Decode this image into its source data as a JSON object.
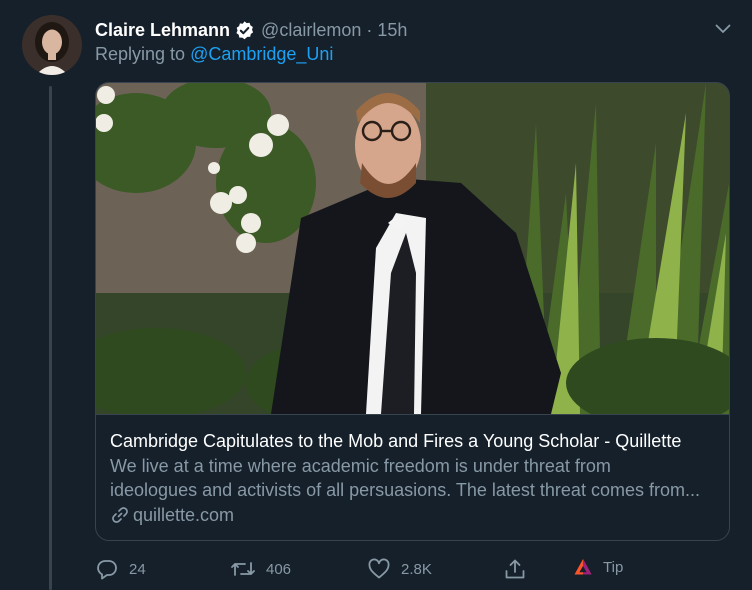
{
  "tweet": {
    "display_name": "Claire Lehmann",
    "handle": "@clairlemon",
    "separator": "·",
    "time": "15h",
    "replying_prefix": "Replying to",
    "replying_to": "@Cambridge_Uni"
  },
  "card": {
    "title": "Cambridge Capitulates to the Mob and Fires a Young Scholar - Quillette",
    "description_line1": "We live at a time where academic freedom is under threat from",
    "description_line2": "ideologues and activists of all persuasions. The latest threat comes from...",
    "domain": "quillette.com"
  },
  "actions": {
    "replies": "24",
    "retweets": "406",
    "likes": "2.8K",
    "tip_label": "Tip"
  },
  "colors": {
    "background": "#15202b",
    "accent": "#1da1f2",
    "secondary_text": "#8899a6",
    "border": "#38444d"
  }
}
